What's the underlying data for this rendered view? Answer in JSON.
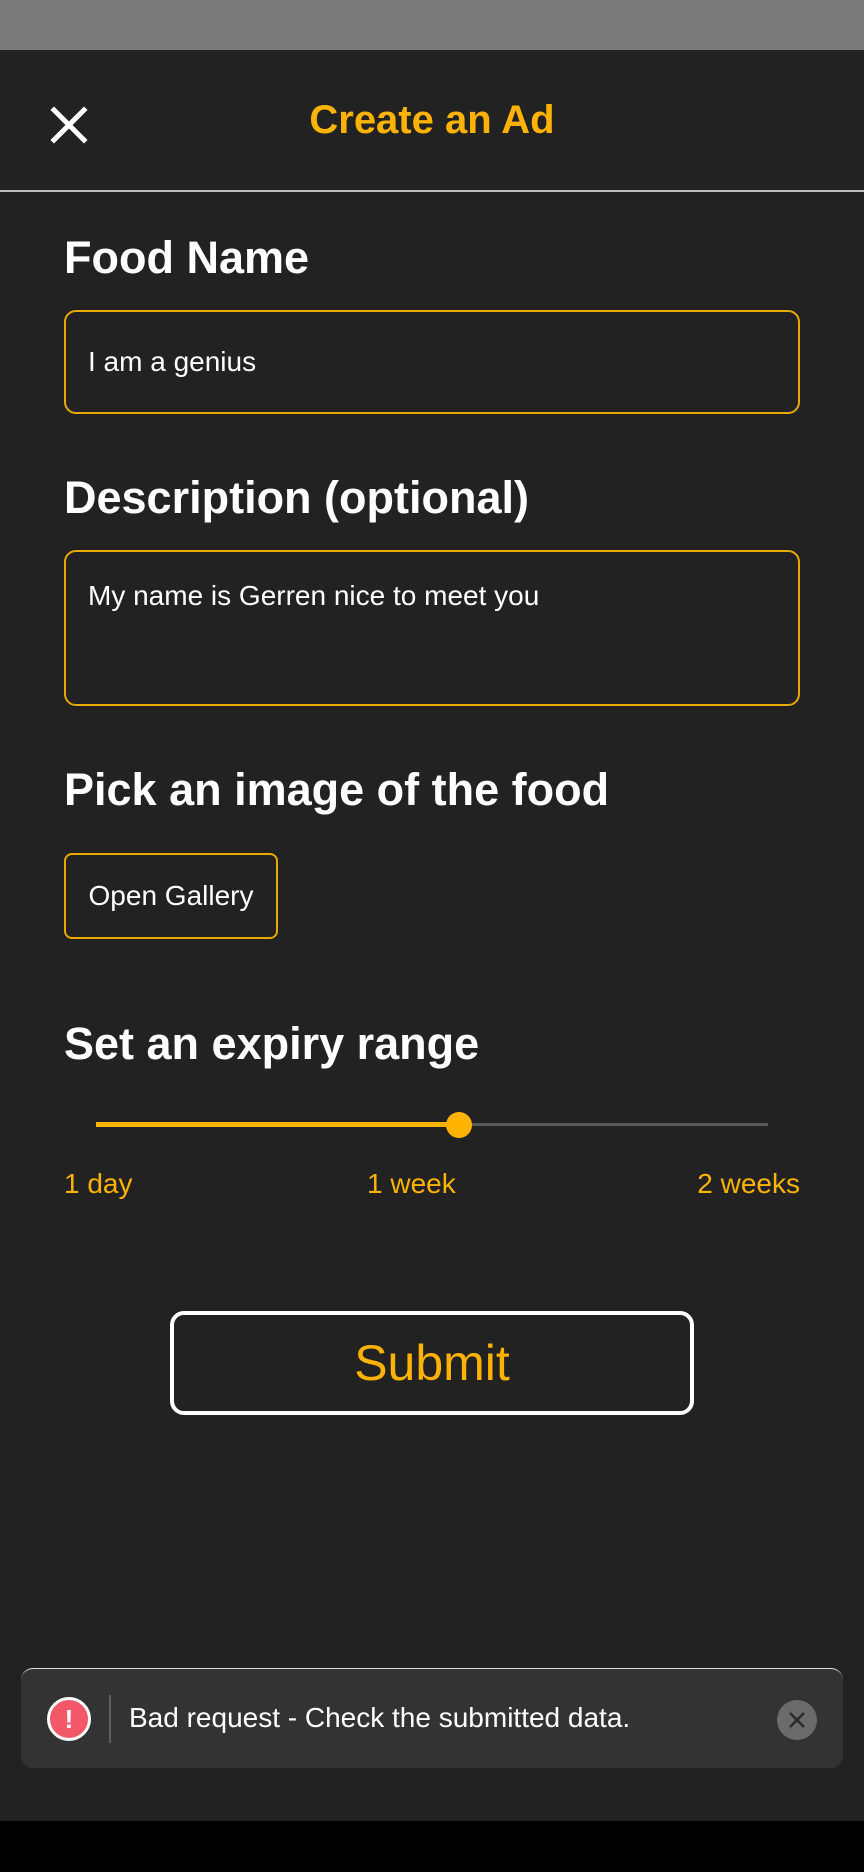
{
  "header": {
    "title": "Create an Ad",
    "close_icon": "close-icon"
  },
  "food_name": {
    "label": "Food Name",
    "value": "I am a genius"
  },
  "description": {
    "label": "Description (optional)",
    "value": "My name is Gerren nice to meet you"
  },
  "image": {
    "label": "Pick an image of the food",
    "button_label": "Open Gallery"
  },
  "expiry": {
    "label": "Set an expiry range",
    "slider_fraction": 0.54,
    "ticks": [
      "1 day",
      "1 week",
      "2 weeks"
    ]
  },
  "submit": {
    "label": "Submit"
  },
  "toast": {
    "message": "Bad request - Check the submitted data.",
    "icon": "error-icon",
    "icon_glyph": "!",
    "close_icon": "close-icon"
  },
  "colors": {
    "accent": "#ffb300",
    "background": "#222222",
    "error": "#f25868"
  }
}
